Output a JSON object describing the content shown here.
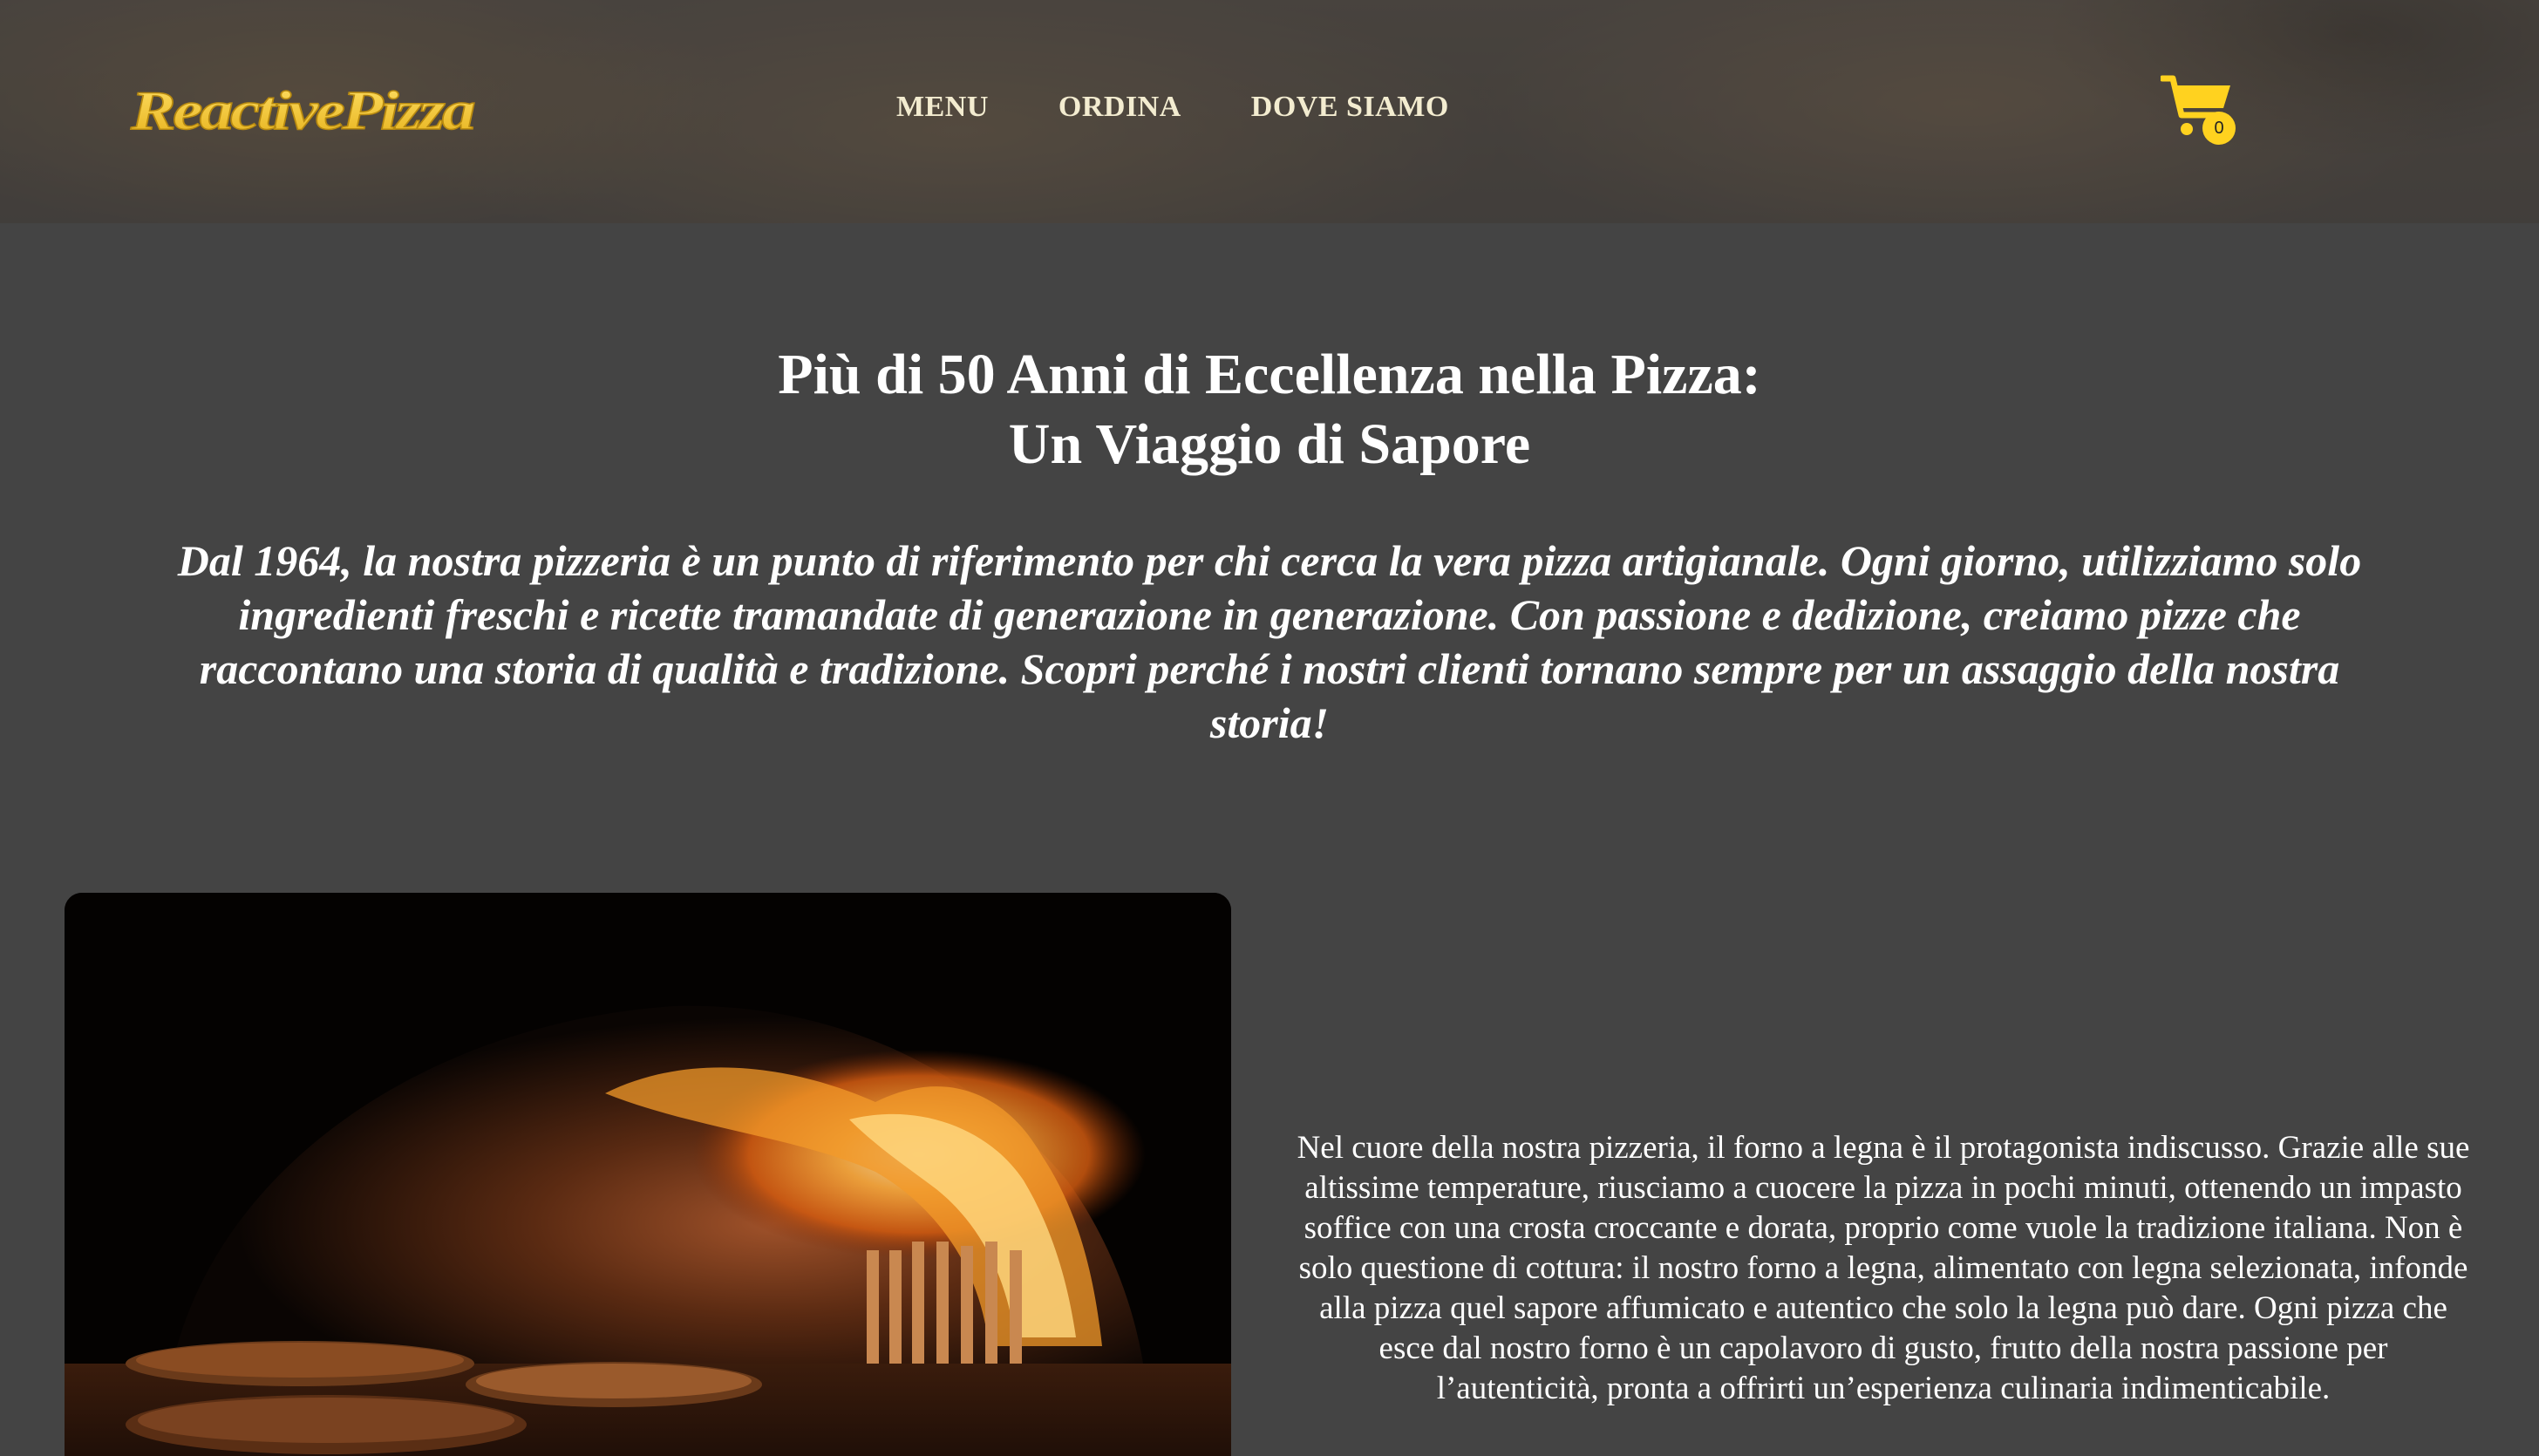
{
  "header": {
    "logo_text": "ReactivePizza",
    "nav": [
      {
        "label": "MENU"
      },
      {
        "label": "ORDINA"
      },
      {
        "label": "DOVE SIAMO"
      }
    ],
    "cart": {
      "count": "0"
    }
  },
  "hero": {
    "title_line1": "Più di 50 Anni di Eccellenza nella Pizza:",
    "title_line2": "Un Viaggio di Sapore",
    "intro": "Dal 1964, la nostra pizzeria è un punto di riferimento per chi cerca la vera pizza artigianale. Ogni giorno, utilizziamo solo ingredienti freschi e ricette tramandate di generazione in generazione. Con passione e dedizione, creiamo pizze che raccontano una storia di qualità e tradizione. Scopri perché i nostri clienti tornano sempre per un assaggio della nostra storia!"
  },
  "oven_section": {
    "text": "Nel cuore della nostra pizzeria, il forno a legna è il protagonista indiscusso. Grazie alle sue altissime temperature, riusciamo a cuocere la pizza in pochi minuti, ottenendo un impasto soffice con una crosta croccante e dorata, proprio come vuole la tradizione italiana. Non è solo questione di cottura: il nostro forno a legna, alimentato con legna selezionata, infonde alla pizza quel sapore affumicato e autentico che solo la legna può dare. Ogni pizza che esce dal nostro forno è un capolavoro di gusto, frutto della nostra passione per l’autenticità, pronta a offrirti un’esperienza culinaria indimenticabile."
  },
  "colors": {
    "background": "#444444",
    "accent": "#ffd21f",
    "text": "#ffffff"
  },
  "icons": {
    "cart": "cart-icon"
  }
}
